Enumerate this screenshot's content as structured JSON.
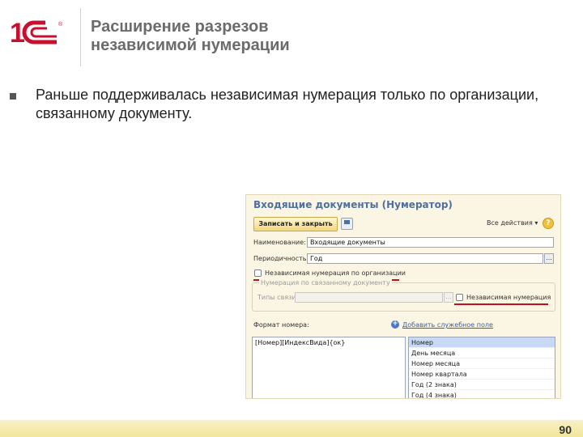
{
  "slide": {
    "title_line1": "Расширение разрезов",
    "title_line2": "независимой нумерации",
    "bullet_text": "Раньше поддерживалась независимая нумерация только по организации, связанному документу.",
    "page_number": "90",
    "logo": {
      "text": "1С",
      "registered": "®",
      "color": "#c8102e"
    }
  },
  "form": {
    "title": "Входящие документы (Нумератор)",
    "toolbar": {
      "save_close_label": "Записать и закрыть",
      "all_actions_label": "Все действия ▾",
      "help_label": "?"
    },
    "name_label": "Наименование:",
    "name_value": "Входящие документы",
    "periodicity_label": "Периодичность:",
    "periodicity_value": "Год",
    "dots_label": "...",
    "org_checkbox_label": "Независимая нумерация по организации",
    "group_title": "Нумерация по связанному документу",
    "types_label": "Типы связи:",
    "types_value": "",
    "independent_checkbox_label": "Независимая нумерация",
    "format_label": "Формат номера:",
    "add_field_label": "Добавить служебное поле",
    "format_value": "[Номер][ИндексВида]{ок}",
    "list_items": [
      "Номер",
      "День месяца",
      "Номер месяца",
      "Номер квартала",
      "Год (2 знака)",
      "Год (4 знака)"
    ],
    "accent_color": "#c0101a"
  }
}
